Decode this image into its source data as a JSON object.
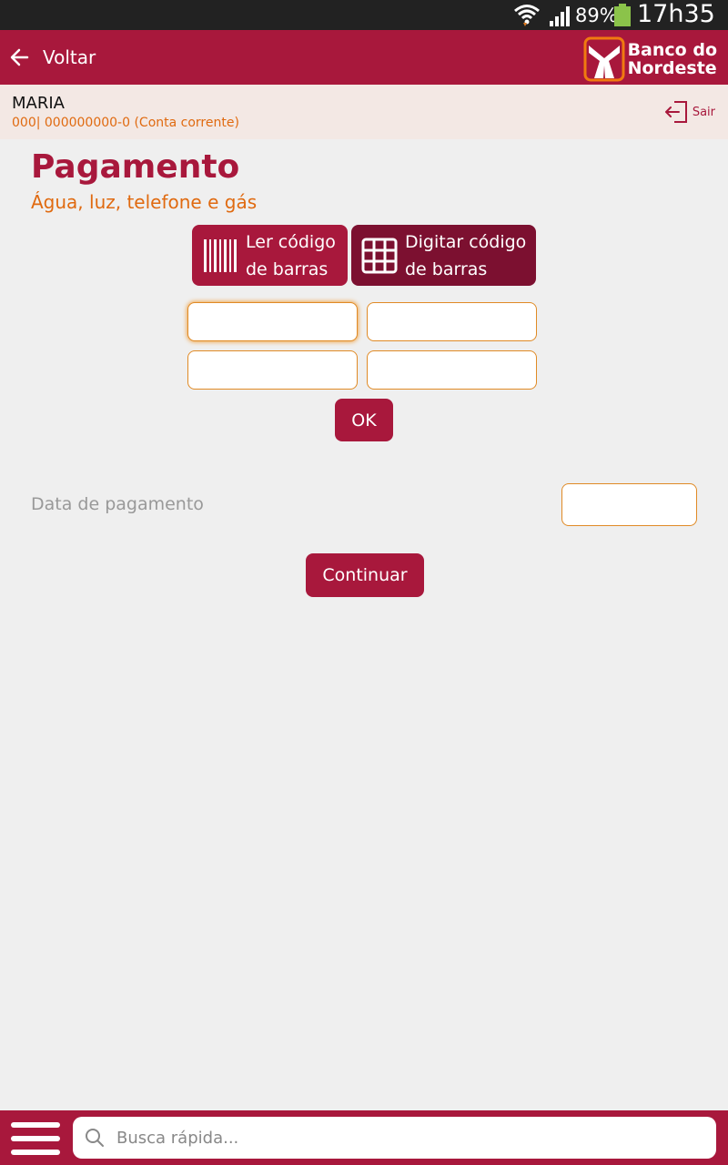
{
  "status_bar": {
    "battery_percent": "89%",
    "time": "17h35"
  },
  "header": {
    "back_label": "Voltar",
    "brand_line1": "Banco do",
    "brand_line2": "Nordeste"
  },
  "account": {
    "name": "MARIA",
    "info": "000| 000000000-0 (Conta corrente)",
    "logout_label": "Sair"
  },
  "page": {
    "title": "Pagamento",
    "subtitle": "Água, luz, telefone e gás"
  },
  "mode_buttons": {
    "scan_line1": "Ler código",
    "scan_line2": "de barras",
    "type_line1": "Digitar código",
    "type_line2": "de barras"
  },
  "code_fields": [
    "",
    "",
    "",
    ""
  ],
  "ok_label": "OK",
  "payment_date": {
    "label": "Data de pagamento",
    "value": ""
  },
  "continue_label": "Continuar",
  "search": {
    "placeholder": "Busca rápida..."
  },
  "colors": {
    "primary": "#a8183c",
    "primary_dark": "#7c1030",
    "accent": "#e06a10"
  }
}
